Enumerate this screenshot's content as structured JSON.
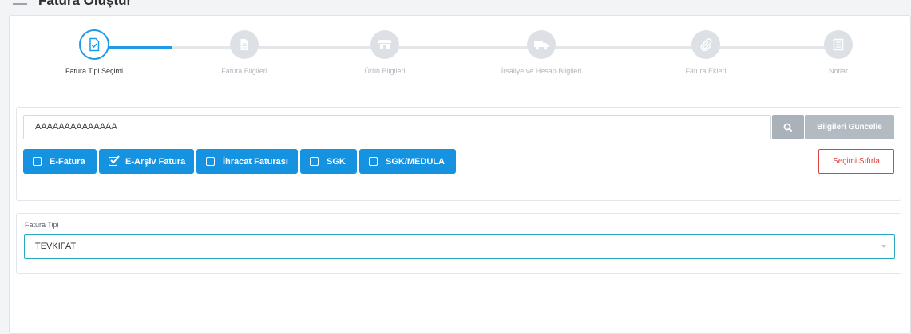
{
  "page": {
    "title": "Fatura Oluştur"
  },
  "stepper": {
    "steps": [
      {
        "label": "Fatura Tipi Seçimi",
        "icon": "document-check-icon",
        "active": true
      },
      {
        "label": "Fatura Bilgileri",
        "icon": "document-icon",
        "active": false
      },
      {
        "label": "Ürün Bilgileri",
        "icon": "store-icon",
        "active": false
      },
      {
        "label": "İrsaliye ve Hesap Bilgileri",
        "icon": "truck-icon",
        "active": false
      },
      {
        "label": "Fatura Ekleri",
        "icon": "paperclip-icon",
        "active": false
      },
      {
        "label": "Notlar",
        "icon": "notes-icon",
        "active": false
      }
    ]
  },
  "search": {
    "value": "AAAAAAAAAAAAAA",
    "update_label": "Bilgileri Güncelle"
  },
  "invoice_types": [
    {
      "label": "E-Fatura",
      "checked": false
    },
    {
      "label": "E-Arşiv Fatura",
      "checked": true
    },
    {
      "label": "İhracat Faturası",
      "checked": false
    },
    {
      "label": "SGK",
      "checked": false
    },
    {
      "label": "SGK/MEDULA",
      "checked": false
    }
  ],
  "reset_label": "Seçimi Sıfırla",
  "fatura_tipi": {
    "label": "Fatura Tipi",
    "value": "TEVKIFAT"
  },
  "colors": {
    "accent": "#1592e0",
    "danger": "#e0443e",
    "muted_button": "#b3bac1"
  }
}
